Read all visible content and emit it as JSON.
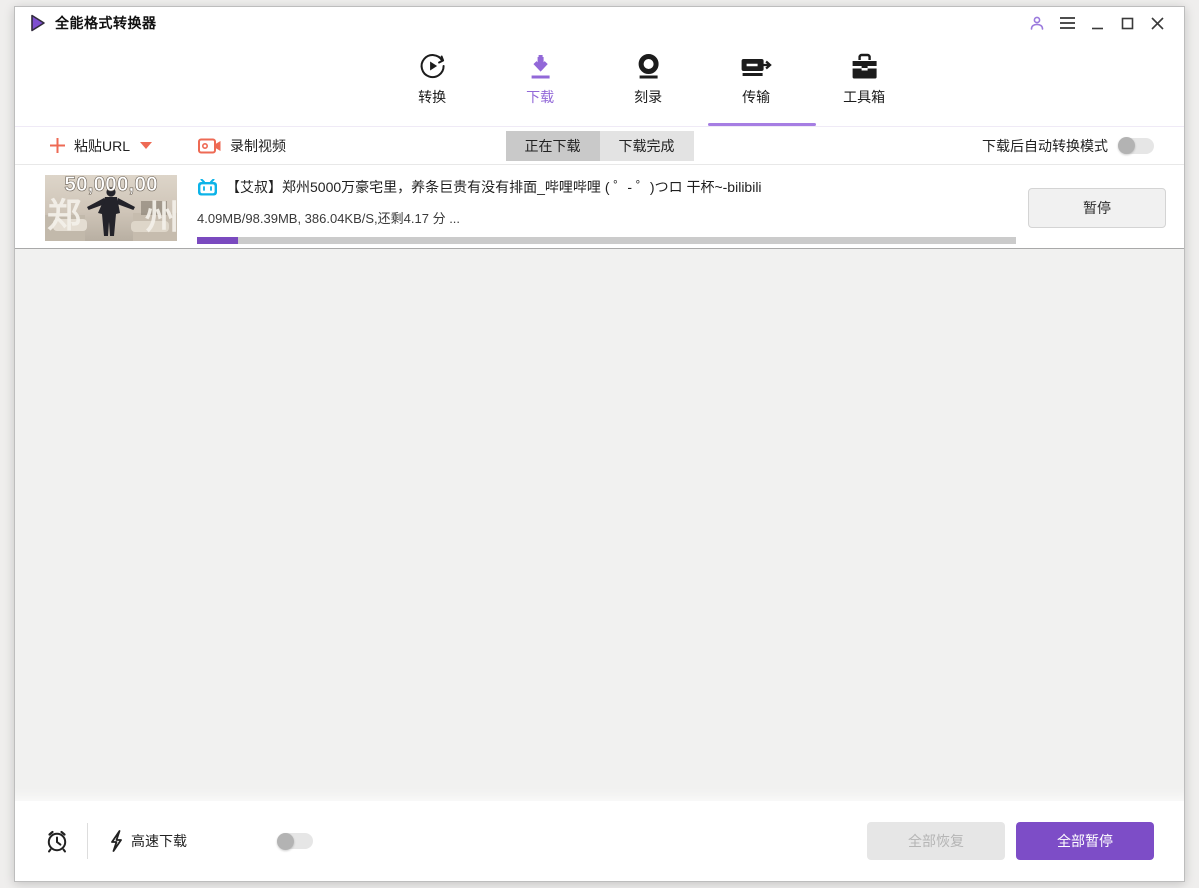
{
  "window": {
    "title": "全能格式转换器",
    "controls": {
      "account": "account",
      "menu": "menu",
      "minimize": "minimize",
      "maximize": "maximize",
      "close": "close"
    }
  },
  "nav": {
    "tabs": [
      {
        "label": "转换",
        "icon": "convert-icon",
        "active": false
      },
      {
        "label": "下载",
        "icon": "download-icon",
        "active": true
      },
      {
        "label": "刻录",
        "icon": "burn-icon",
        "active": false
      },
      {
        "label": "传输",
        "icon": "transfer-icon",
        "active": false
      },
      {
        "label": "工具箱",
        "icon": "toolbox-icon",
        "active": false
      }
    ],
    "active_color": "#9268d8",
    "underline_color": "#a67ee3"
  },
  "toolbar": {
    "paste_url_label": "粘贴URL",
    "record_video_label": "录制视频",
    "subtabs": [
      {
        "label": "正在下载",
        "active": true
      },
      {
        "label": "下载完成",
        "active": false
      }
    ],
    "auto_convert_label": "下载后自动转换模式",
    "auto_convert_on": false
  },
  "downloads": {
    "item": {
      "source_icon": "bilibili-icon",
      "title": "【艾叔】郑州5000万豪宅里，养条巨贵有没有排面_哔哩哔哩 ( ゜- ゜)つロ 干杯~-bilibili",
      "progress_text": "4.09MB/98.39MB, 386.04KB/S,还剩4.17 分 ...",
      "progress_percent": 5,
      "pause_label": "暂停",
      "thumbnail": {
        "price_text": "50,000,00",
        "left_char": "郑",
        "right_char": "州"
      }
    }
  },
  "footer": {
    "schedule_icon": "alarm-clock-icon",
    "speed_icon": "lightning-icon",
    "speed_label": "高速下载",
    "speed_on": false,
    "resume_all_label": "全部恢复",
    "pause_all_label": "全部暂停"
  },
  "colors": {
    "accent_purple": "#7d4dc7",
    "active_tab_purple": "#9268d8",
    "progress_purple": "#7a4abf",
    "toolbar_red": "#ee6a54",
    "bilibili_blue": "#0cb3e8"
  }
}
